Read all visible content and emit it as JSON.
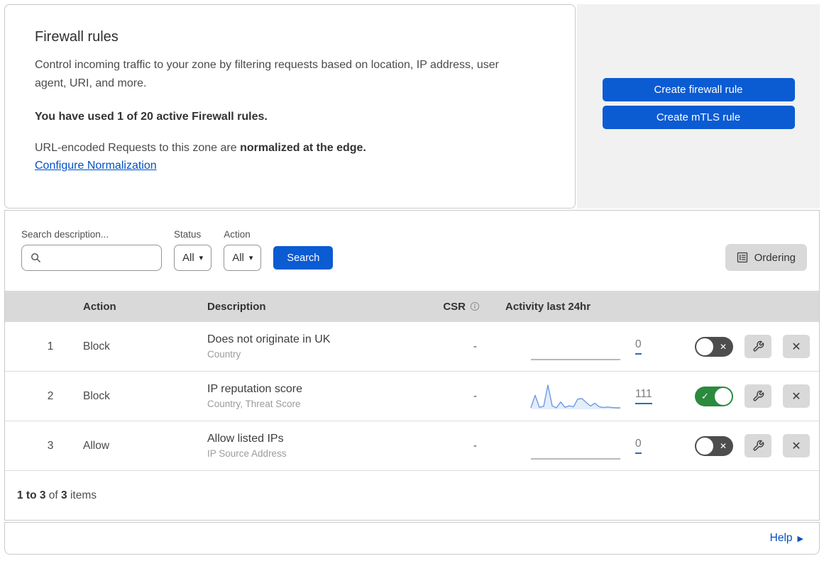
{
  "header": {
    "title": "Firewall rules",
    "description": "Control incoming traffic to your zone by filtering requests based on location, IP address, user agent, URI, and more.",
    "usage": "You have used 1 of 20 active Firewall rules.",
    "normalization_text": "URL-encoded Requests to this zone are",
    "normalization_bold": "normalized at the edge.",
    "normalization_link": "Configure Normalization",
    "create_firewall_label": "Create firewall rule",
    "create_mtls_label": "Create mTLS rule"
  },
  "filters": {
    "search_label": "Search description...",
    "status_label": "Status",
    "status_value": "All",
    "action_label": "Action",
    "action_value": "All",
    "search_button_label": "Search",
    "ordering_label": "Ordering"
  },
  "table": {
    "col_action": "Action",
    "col_description": "Description",
    "col_csr": "CSR",
    "col_activity": "Activity last 24hr",
    "rows": [
      {
        "number": "1",
        "action": "Block",
        "description": "Does not originate in UK",
        "fields": "Country",
        "csr": "-",
        "activity_count": "0",
        "enabled": false,
        "sparkline": []
      },
      {
        "number": "2",
        "action": "Block",
        "description": "IP reputation score",
        "fields": "Country, Threat Score",
        "csr": "-",
        "activity_count": "111",
        "enabled": true,
        "sparkline": [
          6,
          58,
          8,
          12,
          100,
          14,
          6,
          30,
          8,
          14,
          10,
          42,
          44,
          28,
          13,
          25,
          11,
          7,
          9,
          7,
          6,
          6
        ]
      },
      {
        "number": "3",
        "action": "Allow",
        "description": "Allow listed IPs",
        "fields": "IP Source Address",
        "csr": "-",
        "activity_count": "0",
        "enabled": false,
        "sparkline": []
      }
    ]
  },
  "footer": {
    "range": "1 to 3",
    "of_word": "of",
    "total": "3",
    "items_word": "items",
    "help": "Help"
  },
  "icons": {
    "caret_down": "▾",
    "check": "✓",
    "close": "✕",
    "help_arrow": "▶"
  },
  "colors": {
    "button_blue": "#0b5bd3",
    "link_blue": "#0051c3",
    "toggle_on_green": "#2b8a3e",
    "toggle_off_gray": "#4d4d4d",
    "sparkline_blue": "#6b9ae4",
    "sparkline_fill": "rgba(107,154,228,0.18)",
    "flat_line_gray": "#8f8f8f",
    "table_header_gray": "#d9d9d9",
    "panel_gray": "#f1f1f1"
  },
  "chart_data": {
    "type": "line",
    "title": "Activity last 24hr sparkline (rule 2: IP reputation score)",
    "x": "time over last 24 hours (unlabeled ticks)",
    "values": [
      6,
      58,
      8,
      12,
      100,
      14,
      6,
      30,
      8,
      14,
      10,
      42,
      44,
      28,
      13,
      25,
      11,
      7,
      9,
      7,
      6,
      6
    ],
    "ylim": [
      0,
      100
    ],
    "total_events": 111,
    "note": "relative activity, axes unlabeled; rules 1 and 3 show flat zero baselines with totals of 0"
  }
}
